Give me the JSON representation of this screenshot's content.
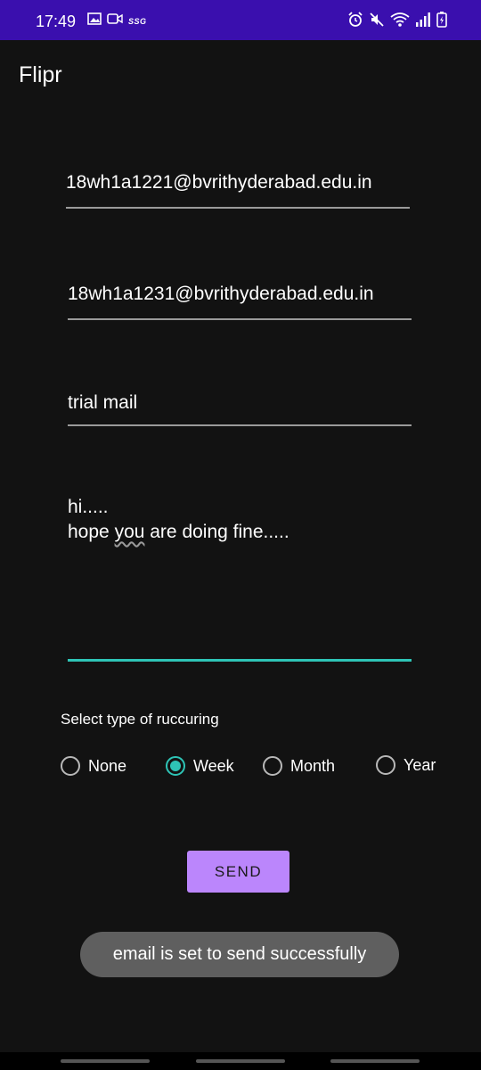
{
  "status_bar": {
    "time": "17:49",
    "carrier_badge": "SSG",
    "bg_color": "#3a0fae",
    "left_icons": [
      "image-icon",
      "video-call-icon"
    ],
    "right_icons": [
      "alarm-icon",
      "mute-icon",
      "wifi-icon",
      "signal-icon",
      "battery-icon"
    ]
  },
  "app_bar": {
    "title": "Flipr"
  },
  "form": {
    "to_email": "18wh1a1221@bvrithyderabad.edu.in",
    "cc_email": "18wh1a1231@bvrithyderabad.edu.in",
    "subject": "trial mail",
    "body_line1": "hi.....",
    "body_line2_pre": "hope ",
    "body_line2_word": "you",
    "body_line2_post": " are doing fine....."
  },
  "recurrence": {
    "label": "Select type of ruccuring",
    "options": [
      "None",
      "Week",
      "Month",
      "Year"
    ],
    "selected": "Week"
  },
  "send_button": {
    "label": "SEND",
    "color": "#bb86fc"
  },
  "toast": {
    "message": "email is set to send successfully"
  },
  "theme": {
    "background": "#121212",
    "accent": "#2ec4b6"
  }
}
